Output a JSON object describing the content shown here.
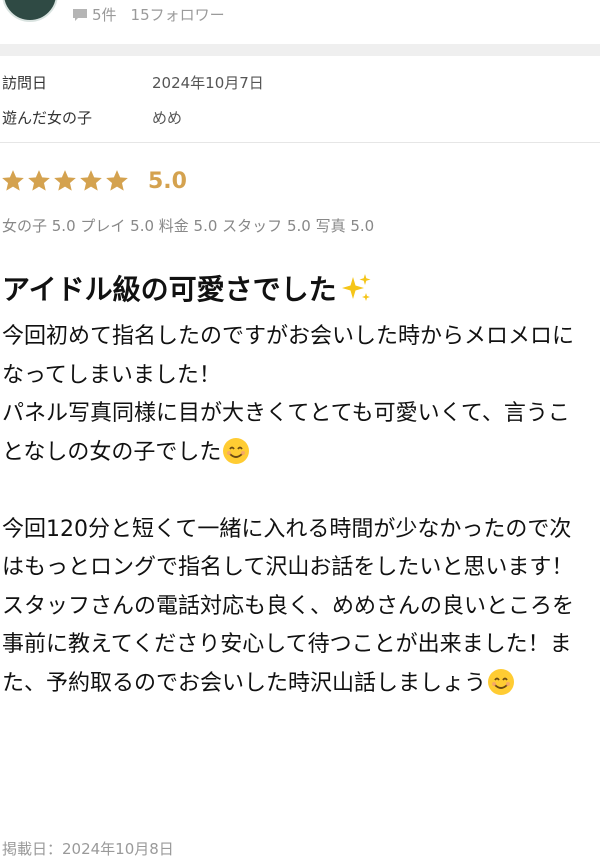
{
  "profile": {
    "review_count": "5件",
    "followers": "15フォロワー"
  },
  "info": {
    "visit_date_label": "訪問日",
    "visit_date_value": "2024年10月7日",
    "girl_label": "遊んだ女の子",
    "girl_value": "めめ"
  },
  "rating": {
    "stars": 5,
    "score": "5.0",
    "star_color": "#d4a24f",
    "breakdown": "女の子 5.0 プレイ 5.0 料金 5.0 スタッフ 5.0 写真 5.0"
  },
  "review": {
    "title": "アイドル級の可愛さでした",
    "title_emoji": "sparkles-icon",
    "p1a": "今回初めて指名したのですがお会いした時からメロメロになってしまいました！\nパネル写真同様に目が大きくてとても可愛いくて、言うことなしの女の子でした",
    "p2a": "\n\n今回120分と短くて一緒に入れる時間が少なかったので次はもっとロングで指名して沢山お話をしたいと思います！\nスタッフさんの電話対応も良く、めめさんの良いところを事前に教えてくださり安心して待つことが出来ました！また、予約取るのでお会いした時沢山話しましょう",
    "emoji_name": "smiling-face-icon"
  },
  "footer": {
    "posted": "掲載日：2024年10月8日"
  }
}
